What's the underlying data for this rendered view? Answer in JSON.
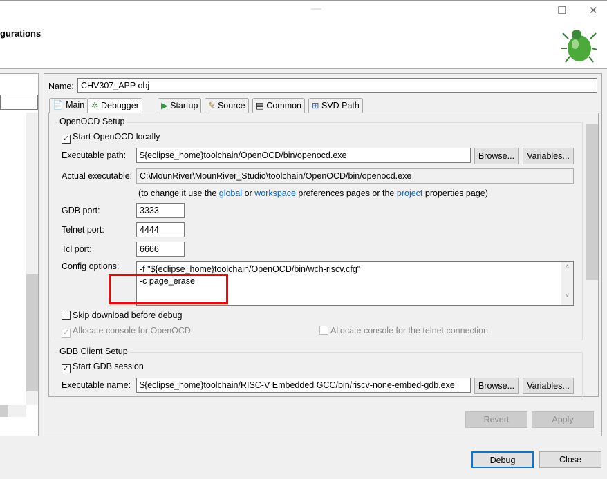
{
  "window": {
    "title": "gurations",
    "minimize": "—",
    "maximize": "☐",
    "close": "✕"
  },
  "name_label": "Name:",
  "name_value": "CHV307_APP obj",
  "tabs": [
    {
      "label": "Main",
      "icon": "page-icon"
    },
    {
      "label": "Debugger",
      "icon": "bug-icon"
    },
    {
      "label": "Startup",
      "icon": "play-icon"
    },
    {
      "label": "Source",
      "icon": "source-icon"
    },
    {
      "label": "Common",
      "icon": "table-icon"
    },
    {
      "label": "SVD Path",
      "icon": "tree-icon"
    }
  ],
  "openocd": {
    "group": "OpenOCD Setup",
    "start_locally": "Start OpenOCD locally",
    "exe_label": "Executable path:",
    "exe_value": "${eclipse_home}toolchain/OpenOCD/bin/openocd.exe",
    "actual_label": "Actual executable:",
    "actual_value": "C:\\MounRiver\\MounRiver_Studio\\toolchain/OpenOCD/bin/openocd.exe",
    "hint_pre": "(to change it use the ",
    "hint_global": "global",
    "hint_or": " or ",
    "hint_workspace": "workspace",
    "hint_mid": " preferences pages or the ",
    "hint_project": "project",
    "hint_post": " properties page)",
    "gdb_port_label": "GDB port:",
    "gdb_port": "3333",
    "telnet_label": "Telnet port:",
    "telnet_port": "4444",
    "tcl_label": "Tcl port:",
    "tcl_port": "6666",
    "config_label": "Config options:",
    "config_line1": "-f \"${eclipse_home}toolchain/OpenOCD/bin/wch-riscv.cfg\"",
    "config_line2": "-c page_erase",
    "skip_download": "Skip download before debug",
    "alloc_console": "Allocate console for OpenOCD",
    "alloc_telnet": "Allocate console for the telnet connection"
  },
  "gdb": {
    "group": "GDB Client Setup",
    "start_session": "Start GDB session",
    "exe_label": "Executable name:",
    "exe_value": "${eclipse_home}toolchain/RISC-V Embedded GCC/bin/riscv-none-embed-gdb.exe"
  },
  "buttons": {
    "browse": "Browse...",
    "variables": "Variables...",
    "revert": "Revert",
    "apply": "Apply",
    "debug": "Debug",
    "close": "Close"
  },
  "highlight_color": "#ff0000"
}
